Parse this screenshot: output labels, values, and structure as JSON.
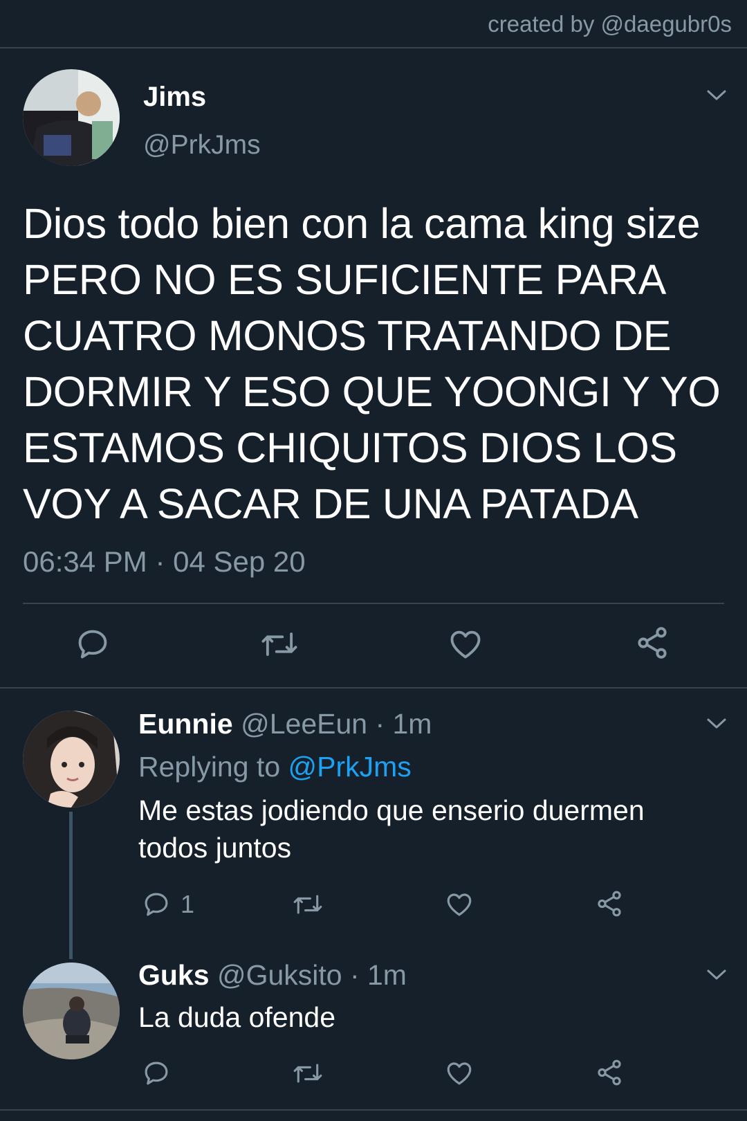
{
  "credit": "created by @daegubr0s",
  "main_tweet": {
    "name": "Jims",
    "handle": "@PrkJms",
    "text": "Dios todo bien con la cama king size PERO NO ES SUFICIENTE PARA CUATRO MONOS TRATANDO DE DORMIR Y ESO QUE YOONGI Y YO ESTAMOS CHIQUITOS DIOS LOS VOY A SACAR DE UNA PATADA",
    "timestamp": "06:34 PM · 04 Sep 20",
    "actions": [
      "reply-icon",
      "retweet-icon",
      "like-icon",
      "share-icon"
    ]
  },
  "replies": [
    {
      "name": "Eunnie",
      "handle": "@LeeEun · 1m",
      "replying_label": "Replying to ",
      "replying_to": "@PrkJms",
      "text": "Me estas jodiendo que enserio duermen todos juntos",
      "reply_count": "1"
    },
    {
      "name": "Guks",
      "handle": "@Guksito · 1m",
      "text": "La duda ofende",
      "reply_count": ""
    }
  ],
  "colors": {
    "background": "#15202b",
    "divider": "#38444d",
    "secondary_text": "#8899a6",
    "link": "#1da1f2"
  }
}
